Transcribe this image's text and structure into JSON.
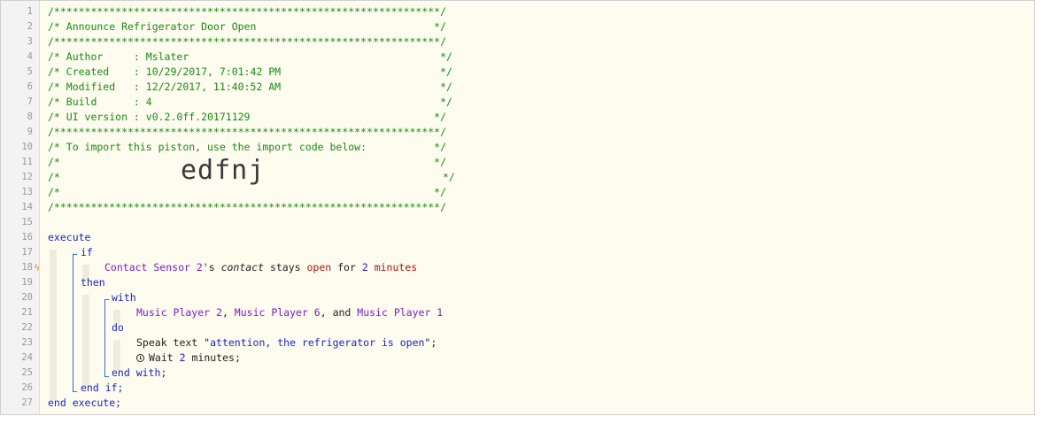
{
  "line_numbers": [
    "1",
    "2",
    "3",
    "4",
    "5",
    "6",
    "7",
    "8",
    "9",
    "10",
    "11",
    "12",
    "13",
    "14",
    "15",
    "16",
    "17",
    "18",
    "19",
    "20",
    "21",
    "22",
    "23",
    "24",
    "25",
    "26",
    "27"
  ],
  "header": {
    "border": "/***************************************************************/",
    "title": "/* Announce Refrigerator Door Open                             */",
    "author": "/* Author     : Mslater                                         */",
    "created": "/* Created    : 10/29/2017, 7:01:42 PM                          */",
    "modified": "/* Modified   : 12/2/2017, 11:40:52 AM                          */",
    "build": "/* Build      : 4                                               */",
    "ui_version": "/* UI version : v0.2.0ff.20171129                              */",
    "import_note": "/* To import this piston, use the import code below:           */",
    "blank_comment": "/*                                                             */",
    "code_prefix": "/*",
    "code_suffix": "*/",
    "import_code": "edfnj"
  },
  "code": {
    "execute": "execute",
    "if": "if",
    "device_contact": "Contact Sensor 2",
    "possessive": "'s ",
    "attribute": "contact",
    "stays": " stays ",
    "state": "open",
    "for": " for ",
    "duration_num": "2",
    "duration_unit": "minutes",
    "then": "then",
    "with": "with",
    "device_mp2": "Music Player 2",
    "comma1": ", ",
    "device_mp6": "Music Player 6",
    "comma_and": ", and ",
    "device_mp1": "Music Player 1",
    "do": "do",
    "speak_prefix": "Speak text \"",
    "speak_text": "attention, the refrigerator is open",
    "speak_suffix": "\";",
    "wait_prefix": "Wait ",
    "wait_num": "2",
    "wait_suffix": " minutes;",
    "end_with": "end with;",
    "end_if": "end if;",
    "end_execute": "end execute;"
  },
  "colors": {
    "comment": "#1a8a12",
    "keyword": "#1c22c8",
    "device": "#7a1fc0",
    "literal": "#b31313",
    "marker": "#f08a24"
  }
}
